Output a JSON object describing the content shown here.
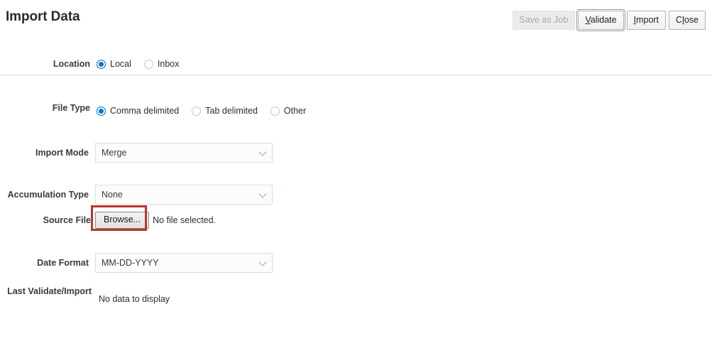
{
  "header": {
    "title": "Import Data",
    "buttons": [
      {
        "label": "Save as Job",
        "state": "disabled"
      },
      {
        "label": "Validate",
        "accesskey": "V",
        "state": "focused"
      },
      {
        "label": "Import",
        "accesskey": "I",
        "state": "normal"
      },
      {
        "label": "Close",
        "accesskey": "l",
        "state": "normal"
      }
    ]
  },
  "form": {
    "location": {
      "label": "Location",
      "options": [
        {
          "label": "Local",
          "selected": true
        },
        {
          "label": "Inbox",
          "selected": false
        }
      ]
    },
    "file_type": {
      "label": "File Type",
      "options": [
        {
          "label": "Comma delimited",
          "selected": true
        },
        {
          "label": "Tab delimited",
          "selected": false
        },
        {
          "label": "Other",
          "selected": false
        }
      ]
    },
    "import_mode": {
      "label": "Import Mode",
      "value": "Merge"
    },
    "accumulation_type": {
      "label": "Accumulation Type",
      "value": "None"
    },
    "source_file": {
      "label": "Source File",
      "browse_label": "Browse...",
      "status": "No file selected."
    },
    "date_format": {
      "label": "Date Format",
      "value": "MM-DD-YYYY"
    },
    "last_validate_import": {
      "label": "Last Validate/Import",
      "empty_message": "No data to display"
    }
  },
  "colors": {
    "accent": "#0572ce",
    "highlight": "#b5392a",
    "divider": "#ccd4dd",
    "title": "#2b2b2b"
  }
}
